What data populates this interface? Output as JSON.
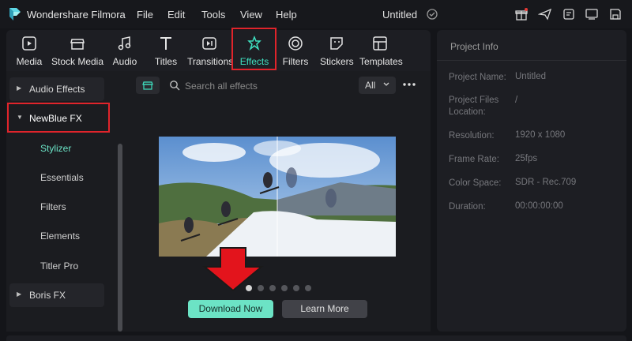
{
  "app": {
    "title": "Wondershare Filmora",
    "project_title": "Untitled"
  },
  "menu": [
    "File",
    "Edit",
    "Tools",
    "View",
    "Help"
  ],
  "toolbar": {
    "items": [
      {
        "label": "Media",
        "icon": "media-icon"
      },
      {
        "label": "Stock Media",
        "icon": "stock-media-icon"
      },
      {
        "label": "Audio",
        "icon": "audio-icon"
      },
      {
        "label": "Titles",
        "icon": "titles-icon"
      },
      {
        "label": "Transitions",
        "icon": "transitions-icon"
      },
      {
        "label": "Effects",
        "icon": "effects-icon",
        "active": true
      },
      {
        "label": "Filters",
        "icon": "filters-icon"
      },
      {
        "label": "Stickers",
        "icon": "stickers-icon"
      },
      {
        "label": "Templates",
        "icon": "templates-icon"
      }
    ]
  },
  "sidebar": {
    "audio_effects": "Audio Effects",
    "newblue_fx": "NewBlue FX",
    "subitems": [
      "Stylizer",
      "Essentials",
      "Filters",
      "Elements",
      "Titler Pro"
    ],
    "boris_fx": "Boris FX"
  },
  "search": {
    "placeholder": "Search all effects",
    "filter_value": "All"
  },
  "promo": {
    "download_label": "Download Now",
    "learn_label": "Learn More",
    "page_count": 6,
    "active_page": 1
  },
  "project_info": {
    "title": "Project Info",
    "rows": [
      {
        "label": "Project Name:",
        "value": "Untitled"
      },
      {
        "label": "Project Files Location:",
        "value": "/"
      },
      {
        "label": "Resolution:",
        "value": "1920 x 1080"
      },
      {
        "label": "Frame Rate:",
        "value": "25fps"
      },
      {
        "label": "Color Space:",
        "value": "SDR - Rec.709"
      },
      {
        "label": "Duration:",
        "value": "00:00:00:00"
      }
    ]
  },
  "colors": {
    "accent": "#3fe0c0",
    "download_bg": "#6ce3c5",
    "highlight": "#e0242b",
    "arrow": "#e3141c"
  }
}
